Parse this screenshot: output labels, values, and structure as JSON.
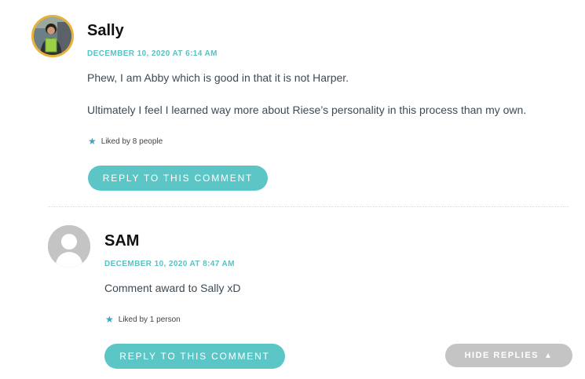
{
  "comments": [
    {
      "author": "Sally",
      "date": "DECEMBER 10, 2020 AT 6:14 AM",
      "paragraphs": [
        "Phew, I am Abby which is good in that it is not Harper.",
        "Ultimately I feel I learned way more about Riese’s personality in this process than my own."
      ],
      "likes": "Liked by 8 people",
      "reply_label": "REPLY TO THIS COMMENT"
    },
    {
      "author": "SAM",
      "date": "DECEMBER 10, 2020 AT 8:47 AM",
      "paragraphs": [
        "Comment award to Sally xD"
      ],
      "likes": "Liked by 1 person",
      "reply_label": "REPLY TO THIS COMMENT"
    }
  ],
  "hide_replies_label": "HIDE REPLIES",
  "icons": {
    "like": "star-icon",
    "hide": "triangle-up-icon",
    "avatar_default": "default-avatar-icon"
  },
  "colors": {
    "accent": "#5cc6c6",
    "date": "#55c3c3",
    "avatar_border": "#e7b23a",
    "hide_button": "#c4c4c4"
  }
}
